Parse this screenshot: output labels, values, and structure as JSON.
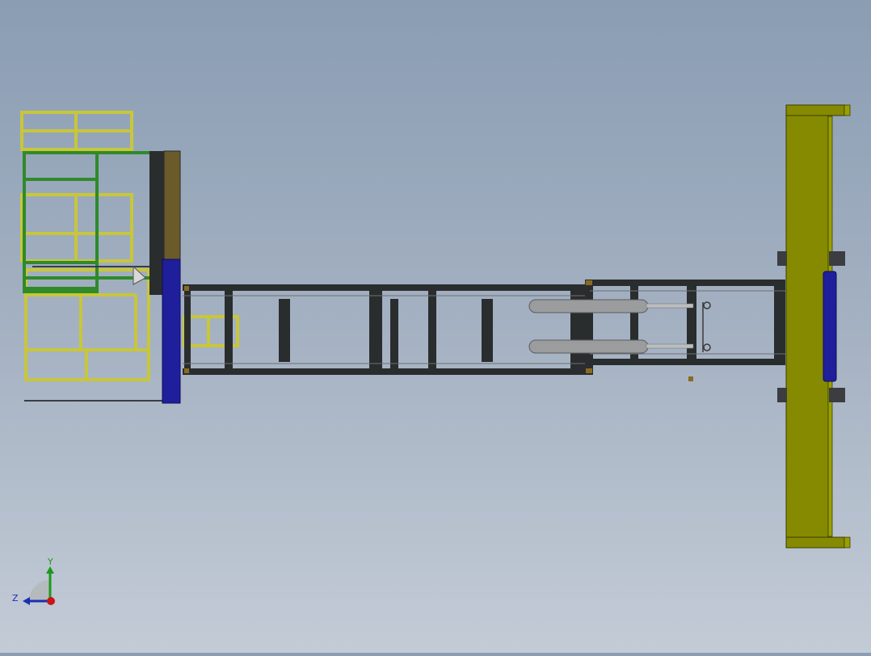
{
  "view": {
    "kind": "CAD top view",
    "colors": {
      "yellow_frame": "#c8c63a",
      "green_frame": "#2f8a2a",
      "olive_plate": "#858a00",
      "blue_plate": "#1f1f9c",
      "dark_steel": "#2a2d2e",
      "cylinder_grey": "#9a9c9e",
      "brown_panel": "#6b5a2a"
    }
  },
  "triad": {
    "y_label": "Y",
    "z_label": "Z",
    "y_color": "#1a9a1a",
    "z_color": "#1a2fb0",
    "x_color": "#c81414"
  }
}
